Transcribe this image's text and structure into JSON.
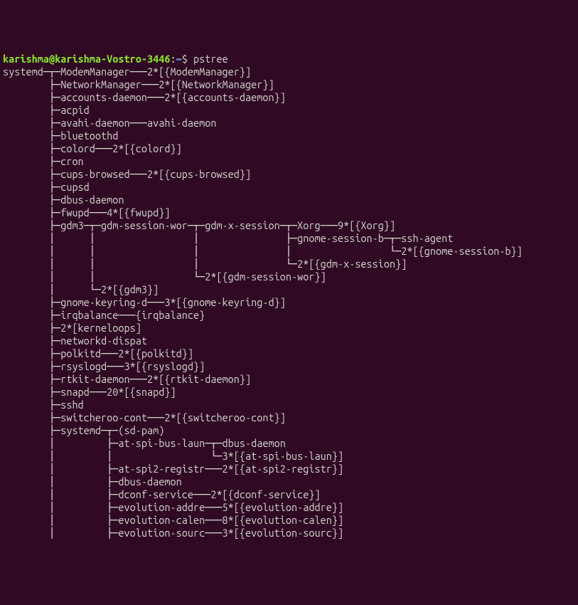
{
  "prompt": {
    "user_host": "karishma@karishma-Vostro-3446",
    "separator": ":",
    "tilde": "~",
    "dollar": "$ "
  },
  "command": "pstree",
  "tree_lines": [
    "systemd─┬─ModemManager───2*[{ModemManager}]",
    "        ├─NetworkManager───2*[{NetworkManager}]",
    "        ├─accounts-daemon───2*[{accounts-daemon}]",
    "        ├─acpid",
    "        ├─avahi-daemon───avahi-daemon",
    "        ├─bluetoothd",
    "        ├─colord───2*[{colord}]",
    "        ├─cron",
    "        ├─cups-browsed───2*[{cups-browsed}]",
    "        ├─cupsd",
    "        ├─dbus-daemon",
    "        ├─fwupd───4*[{fwupd}]",
    "        ├─gdm3─┬─gdm-session-wor─┬─gdm-x-session─┬─Xorg───9*[{Xorg}]",
    "        │      │                 │               ├─gnome-session-b─┬─ssh-agent",
    "        │      │                 │               │                 └─2*[{gnome-session-b}]",
    "        │      │                 │               └─2*[{gdm-x-session}]",
    "        │      │                 └─2*[{gdm-session-wor}]",
    "        │      └─2*[{gdm3}]",
    "        ├─gnome-keyring-d───3*[{gnome-keyring-d}]",
    "        ├─irqbalance───{irqbalance}",
    "        ├─2*[kerneloops]",
    "        ├─networkd-dispat",
    "        ├─polkitd───2*[{polkitd}]",
    "        ├─rsyslogd───3*[{rsyslogd}]",
    "        ├─rtkit-daemon───2*[{rtkit-daemon}]",
    "        ├─snapd───20*[{snapd}]",
    "        ├─sshd",
    "        ├─switcheroo-cont───2*[{switcheroo-cont}]",
    "        ├─systemd─┬─(sd-pam)",
    "        │         ├─at-spi-bus-laun─┬─dbus-daemon",
    "        │         │                 └─3*[{at-spi-bus-laun}]",
    "        │         ├─at-spi2-registr───2*[{at-spi2-registr}]",
    "        │         ├─dbus-daemon",
    "        │         ├─dconf-service───2*[{dconf-service}]",
    "        │         ├─evolution-addre───5*[{evolution-addre}]",
    "        │         ├─evolution-calen───8*[{evolution-calen}]",
    "        │         ├─evolution-sourc───3*[{evolution-sourc}]"
  ]
}
